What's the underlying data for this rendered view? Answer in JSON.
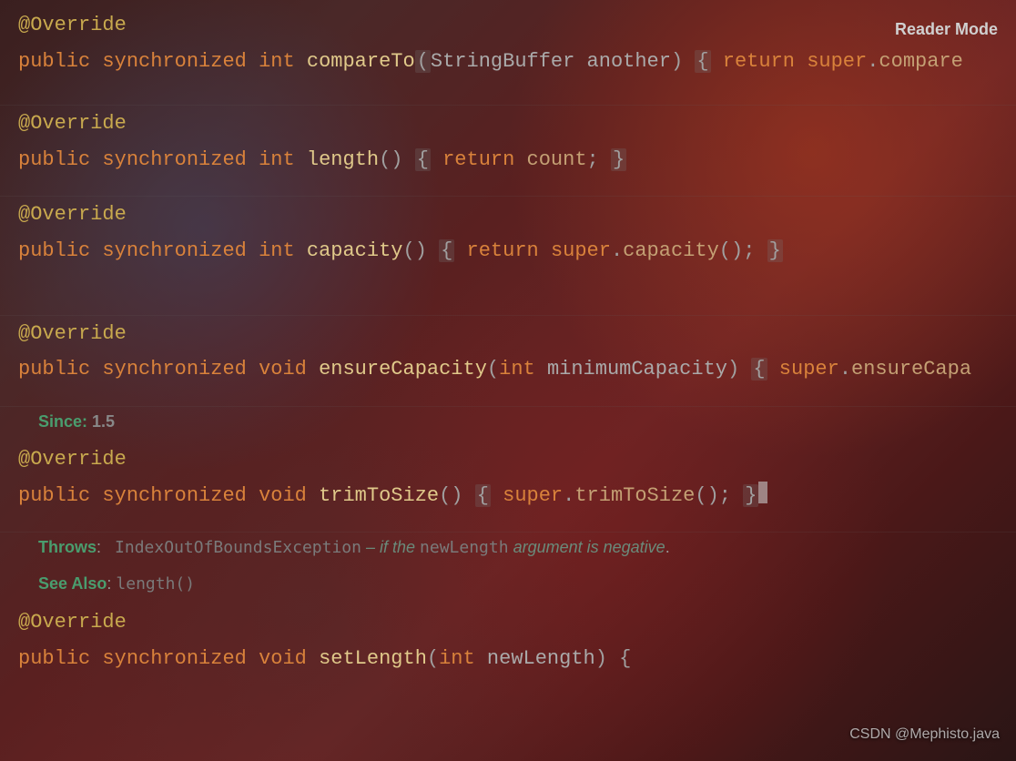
{
  "ui": {
    "reader_mode": "Reader Mode",
    "watermark": "CSDN @Mephisto.java"
  },
  "tokens": {
    "annotation": "@Override",
    "public": "public",
    "synchronized": "synchronized",
    "int": "int",
    "void": "void",
    "return": "return",
    "super": "super",
    "lparen": "(",
    "rparen": ")",
    "lbrace": "{",
    "rbrace": "}",
    "semi": ";",
    "dot": ".",
    "parens": "()"
  },
  "methods": {
    "compareTo": {
      "name": "compareTo",
      "param_type": "StringBuffer",
      "param_name": "another",
      "call": "compare"
    },
    "length": {
      "name": "length",
      "ret_value": "count"
    },
    "capacity": {
      "name": "capacity",
      "call": "capacity"
    },
    "ensureCapacity": {
      "name": "ensureCapacity",
      "param_type": "int",
      "param_name": "minimumCapacity",
      "call": "ensureCapa"
    },
    "trimToSize": {
      "name": "trimToSize",
      "call": "trimToSize"
    },
    "setLength": {
      "name": "setLength",
      "param_type": "int",
      "param_name": "newLength"
    }
  },
  "docs": {
    "since_label": "Since: ",
    "since_value": "1.5",
    "throws_label": "Throws",
    "throws_colon": ":",
    "throws_exception": "IndexOutOfBoundsException",
    "throws_dash": " – if the ",
    "throws_param": "newLength",
    "throws_rest": " argument is negative",
    "throws_period": ".",
    "seealso_label": "See Also",
    "seealso_colon": ": ",
    "seealso_link": "length()"
  }
}
